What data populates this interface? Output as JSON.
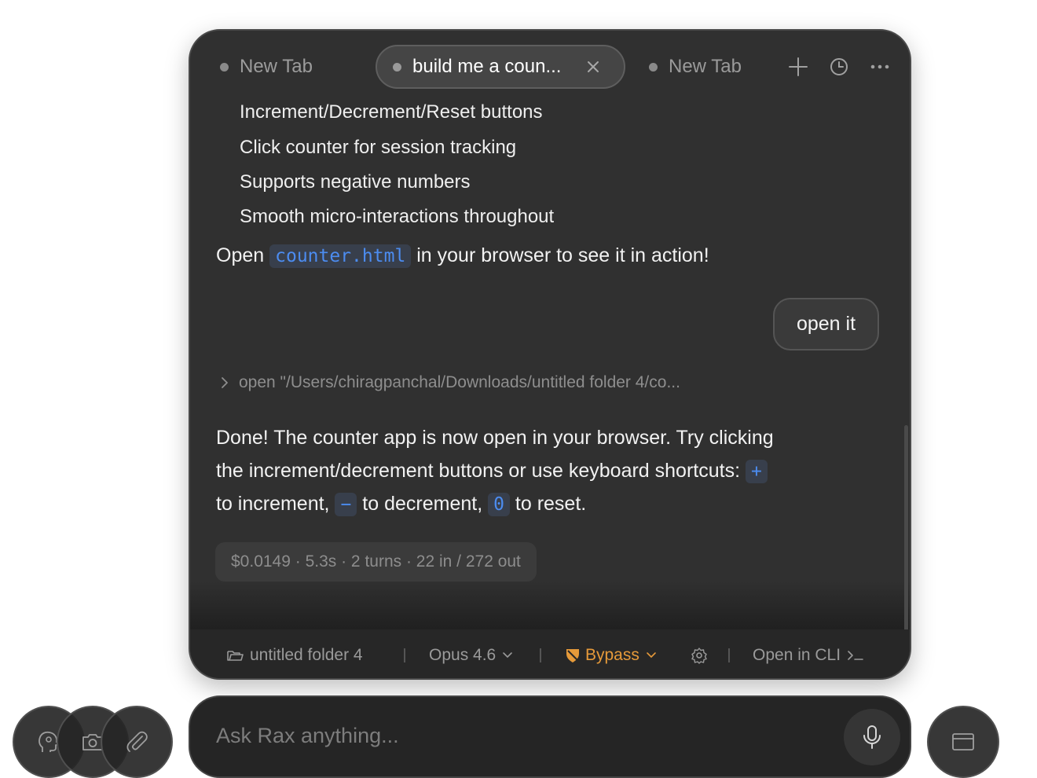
{
  "tabs": [
    {
      "label": "New Tab",
      "active": false
    },
    {
      "label": "build me a coun...",
      "active": true
    },
    {
      "label": "New Tab",
      "active": false
    }
  ],
  "toolbar_icons": [
    "plus-icon",
    "history-icon",
    "more-icon"
  ],
  "assistant_previous": {
    "list_items": [
      "Increment/Decrement/Reset buttons",
      "Click counter for session tracking",
      "Supports negative numbers",
      "Smooth micro-interactions throughout"
    ],
    "open_prefix": "Open",
    "open_file": "counter.html",
    "open_suffix": "in your browser to see it in action!"
  },
  "user_message": "open it",
  "tool_call": {
    "text": "open \"/Users/chiragpanchal/Downloads/untitled folder 4/co..."
  },
  "assistant_reply": {
    "line1": "Done! The counter app is now open in your browser. Try clicking",
    "line2_prefix": "the increment/decrement buttons or use keyboard shortcuts:",
    "key_plus": "+",
    "line3_prefix": "to increment,",
    "key_minus": "−",
    "line3_mid": "to decrement,",
    "key_zero": "0",
    "line3_suffix": "to reset."
  },
  "stats": "$0.0149 · 5.3s · 2 turns · 22 in / 272 out",
  "footer": {
    "folder": "untitled folder 4",
    "model": "Opus 4.6",
    "permission": "Bypass",
    "open_cli": "Open in CLI",
    "accent_color": "#e69a3a"
  },
  "input": {
    "placeholder": "Ask Rax anything..."
  }
}
